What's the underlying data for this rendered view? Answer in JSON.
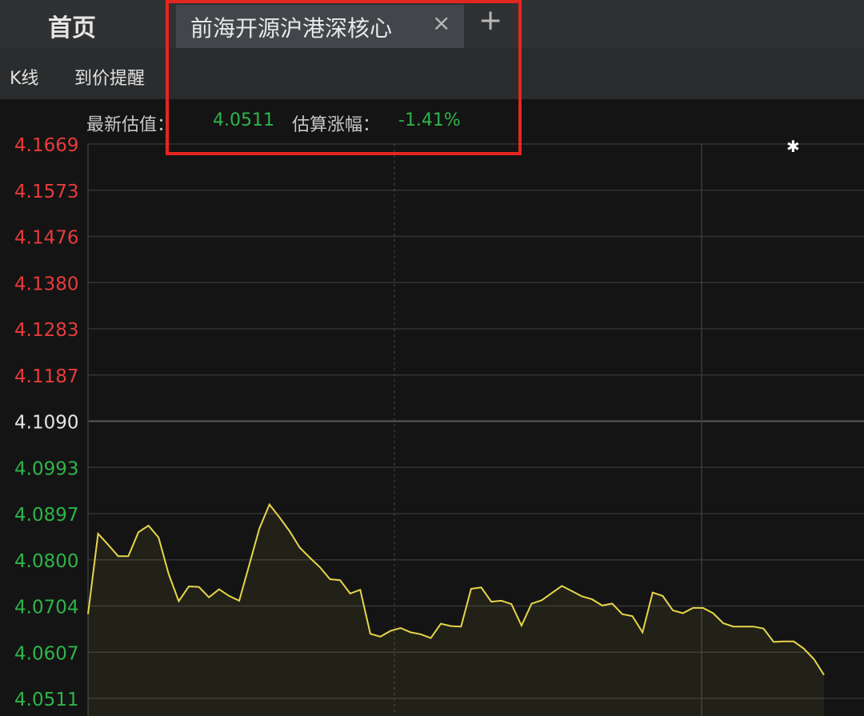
{
  "tabs": {
    "home": "首页",
    "active": "前海开源沪港深核心",
    "close_icon": "×",
    "add_icon": "+"
  },
  "toolbar": {
    "kline": "K线",
    "price_alert": "到价提醒"
  },
  "estimate": {
    "value_label": "最新估值：",
    "value": "4.0511",
    "change_label": "估算涨幅：",
    "change": "-1.41%"
  },
  "colors": {
    "up": "#e83b3b",
    "down": "#2fb44a",
    "base": "#e6e6e6",
    "line": "#e6d64a",
    "highlight": "#e4261f"
  },
  "chart_data": {
    "type": "line",
    "y_ticks": [
      "4.1669",
      "4.1573",
      "4.1476",
      "4.1380",
      "4.1283",
      "4.1187",
      "4.1090",
      "4.0993",
      "4.0897",
      "4.0800",
      "4.0704",
      "4.0607",
      "4.0511"
    ],
    "base_value": 4.109,
    "ylim": [
      4.0511,
      4.1669
    ],
    "values": [
      4.0687,
      4.0855,
      4.0832,
      4.0808,
      4.0808,
      4.0858,
      4.0872,
      4.0847,
      4.0771,
      4.0714,
      4.0745,
      4.0744,
      4.0722,
      4.0739,
      4.0725,
      4.0715,
      4.079,
      4.0866,
      4.0916,
      4.0889,
      4.086,
      4.0826,
      4.0805,
      4.0785,
      4.076,
      4.0758,
      4.073,
      4.0738,
      4.0646,
      4.064,
      4.0652,
      4.0658,
      4.0649,
      4.0645,
      4.0637,
      4.0667,
      4.0662,
      4.0661,
      4.074,
      4.0743,
      4.0713,
      4.0715,
      4.0708,
      4.0663,
      4.0709,
      4.0716,
      4.0731,
      4.0746,
      4.0735,
      4.0724,
      4.0718,
      4.0705,
      4.0709,
      4.0687,
      4.0683,
      4.0649,
      4.0732,
      4.0725,
      4.0695,
      4.0689,
      4.07,
      4.07,
      4.0689,
      4.0668,
      4.0661,
      4.0661,
      4.0661,
      4.0657,
      4.0629,
      4.063,
      4.063,
      4.0615,
      4.0593,
      4.056
    ]
  }
}
